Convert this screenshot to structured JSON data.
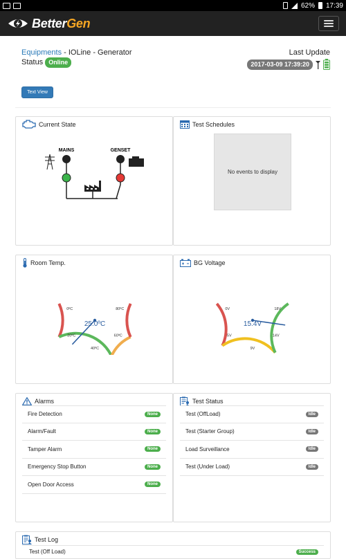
{
  "statusbar": {
    "battery": "62%",
    "time": "17:39"
  },
  "app": {
    "logo_part1": "Better",
    "logo_part2": "Gen"
  },
  "header": {
    "crumb_link": "Equipments",
    "crumb_rest": " - IOLine - Generator",
    "status_label": "Status",
    "status_badge": "Online",
    "last_update_label": "Last Update",
    "last_update_value": "2017-03-09 17:39:20"
  },
  "text_view_button": "Text View",
  "current_state": {
    "title": "Current State",
    "mains_label": "MAINS",
    "genset_label": "GENSET"
  },
  "test_schedules": {
    "title": "Test Schedules",
    "empty_text": "No events to display"
  },
  "room_temp": {
    "title": "Room Temp.",
    "value_label": "25.0ºC",
    "value": 25.0,
    "min": 0,
    "max": 80,
    "ticks": [
      "0ºC",
      "20ºC",
      "40ºC",
      "60ºC",
      "80ºC"
    ],
    "colors": {
      "low": "#d9534f",
      "mid": "#5cb85c",
      "high": "#f0ad4e"
    }
  },
  "bg_voltage": {
    "title": "BG Voltage",
    "value_label": "15.4V",
    "value": 15.4,
    "min": 0,
    "max": 18,
    "ticks": [
      "0V",
      "5V",
      "9V",
      "14V",
      "18V"
    ],
    "colors": {
      "low": "#d9534f",
      "mid": "#f0c020",
      "high": "#5cb85c"
    }
  },
  "alarms": {
    "title": "Alarms",
    "items": [
      {
        "label": "Fire Detection",
        "status": "None"
      },
      {
        "label": "Alarm/Fault",
        "status": "None"
      },
      {
        "label": "Tamper Alarm",
        "status": "None"
      },
      {
        "label": "Emergency Stop Button",
        "status": "None"
      },
      {
        "label": "Open Door Access",
        "status": "None"
      }
    ]
  },
  "test_status": {
    "title": "Test Status",
    "items": [
      {
        "label": "Test (OffLoad)",
        "status": "Idle"
      },
      {
        "label": "Test (Starter Group)",
        "status": "Idle"
      },
      {
        "label": "Load Surveillance",
        "status": "Idle"
      },
      {
        "label": "Test (Under Load)",
        "status": "Idle"
      }
    ]
  },
  "test_log": {
    "title": "Test Log",
    "first_item": "Test (Off Load)",
    "first_status": "Success"
  },
  "colors": {
    "primary": "#337ab7",
    "success": "#4cae4c",
    "navbar": "#222222",
    "accent": "#f5a623"
  }
}
